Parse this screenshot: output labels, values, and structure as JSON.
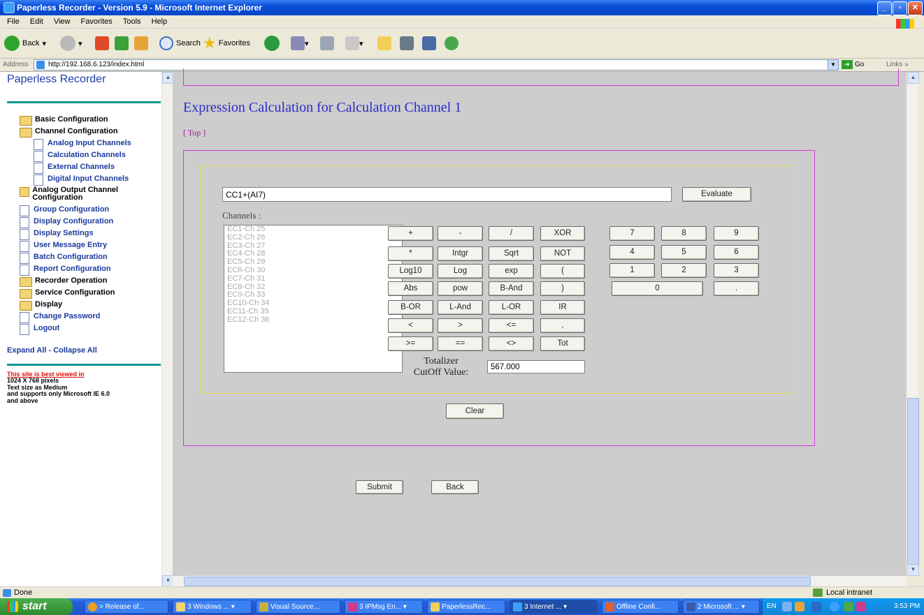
{
  "window": {
    "title": "Paperless Recorder - Version 5.9 - Microsoft Internet Explorer"
  },
  "menu": [
    "File",
    "Edit",
    "View",
    "Favorites",
    "Tools",
    "Help"
  ],
  "toolbar": {
    "back": "Back",
    "search": "Search",
    "favorites": "Favorites"
  },
  "address": {
    "label": "Address",
    "url": "http://192.168.6.123/index.html",
    "go": "Go",
    "links": "Links"
  },
  "nav": {
    "title": "Paperless Recorder",
    "items": [
      {
        "label": "Basic Configuration",
        "icon": "folder-icon"
      },
      {
        "label": "Channel Configuration",
        "icon": "folder-open-icon"
      },
      {
        "label": "Analog Input Channels",
        "icon": "document-icon"
      },
      {
        "label": "Calculation Channels",
        "icon": "document-icon"
      },
      {
        "label": "External Channels",
        "icon": "document-icon"
      },
      {
        "label": "Digital Input Channels",
        "icon": "document-icon"
      },
      {
        "label": "Analog Output Channel Configuration",
        "icon": "folder-icon"
      },
      {
        "label": "Group Configuration",
        "icon": "document-icon"
      },
      {
        "label": "Display Configuration",
        "icon": "document-icon"
      },
      {
        "label": "Display Settings",
        "icon": "document-icon"
      },
      {
        "label": "User Message Entry",
        "icon": "document-icon"
      },
      {
        "label": "Batch Configuration",
        "icon": "document-icon"
      },
      {
        "label": "Report Configuration",
        "icon": "document-icon"
      },
      {
        "label": "Recorder Operation",
        "icon": "folder-icon"
      },
      {
        "label": "Service Configuration",
        "icon": "folder-icon"
      },
      {
        "label": "Display",
        "icon": "folder-icon"
      },
      {
        "label": "Change Password",
        "icon": "document-icon"
      },
      {
        "label": "Logout",
        "icon": "document-icon"
      }
    ],
    "expand_collapse": "Expand All - Collapse All",
    "best_viewed": "This site is best viewed in",
    "notes": [
      "1024 X 768 pixels",
      "Text size as Medium",
      "and supports only Microsoft IE 6.0",
      "and above"
    ]
  },
  "main": {
    "title": "Expression Calculation for Calculation Channel 1",
    "top_link": "[ Top ]",
    "expression_value": "CC1+(AI7)",
    "evaluate": "Evaluate",
    "channels_label": "Channels :",
    "channels": [
      "EC1-Ch 25",
      "EC2-Ch 26",
      "EC3-Ch 27",
      "EC4-Ch 28",
      "EC5-Ch 29",
      "EC6-Ch 30",
      "EC7-Ch 31",
      "EC8-Ch 32",
      "EC9-Ch 33",
      "EC10-Ch 34",
      "EC11-Ch 35",
      "EC12-Ch 36"
    ],
    "operators": [
      [
        "+",
        "-",
        "/",
        "XOR"
      ],
      [
        "*",
        "Intgr",
        "Sqrt",
        "NOT"
      ],
      [
        "Log10",
        "Log",
        "exp",
        "("
      ],
      [
        "Abs",
        "pow",
        "B-And",
        ")"
      ],
      [
        "B-OR",
        "L-And",
        "L-OR",
        "IR"
      ],
      [
        "<",
        ">",
        "<=",
        ","
      ],
      [
        ">=",
        "==",
        "<>",
        "Tot"
      ]
    ],
    "digits": [
      [
        "7",
        "8",
        "9"
      ],
      [
        "4",
        "5",
        "6"
      ],
      [
        "1",
        "2",
        "3"
      ]
    ],
    "zero": "0",
    "dot": ".",
    "totalizer_label_1": "Totalizer",
    "totalizer_label_2": "CutOff Value:",
    "totalizer_value": "567.000",
    "clear": "Clear",
    "submit": "Submit",
    "back": "Back"
  },
  "status": {
    "text": "Done",
    "zone": "Local intranet"
  },
  "taskbar": {
    "start": "start",
    "tasks": [
      "> Release of...",
      "3 Windows ...",
      "Visual Source...",
      "3 IPMsg En...",
      "PaperlessRec...",
      "3 Internet ...",
      "Offline Confi...",
      "2 Microsoft ..."
    ],
    "lang": "EN",
    "clock": "3:53 PM"
  }
}
